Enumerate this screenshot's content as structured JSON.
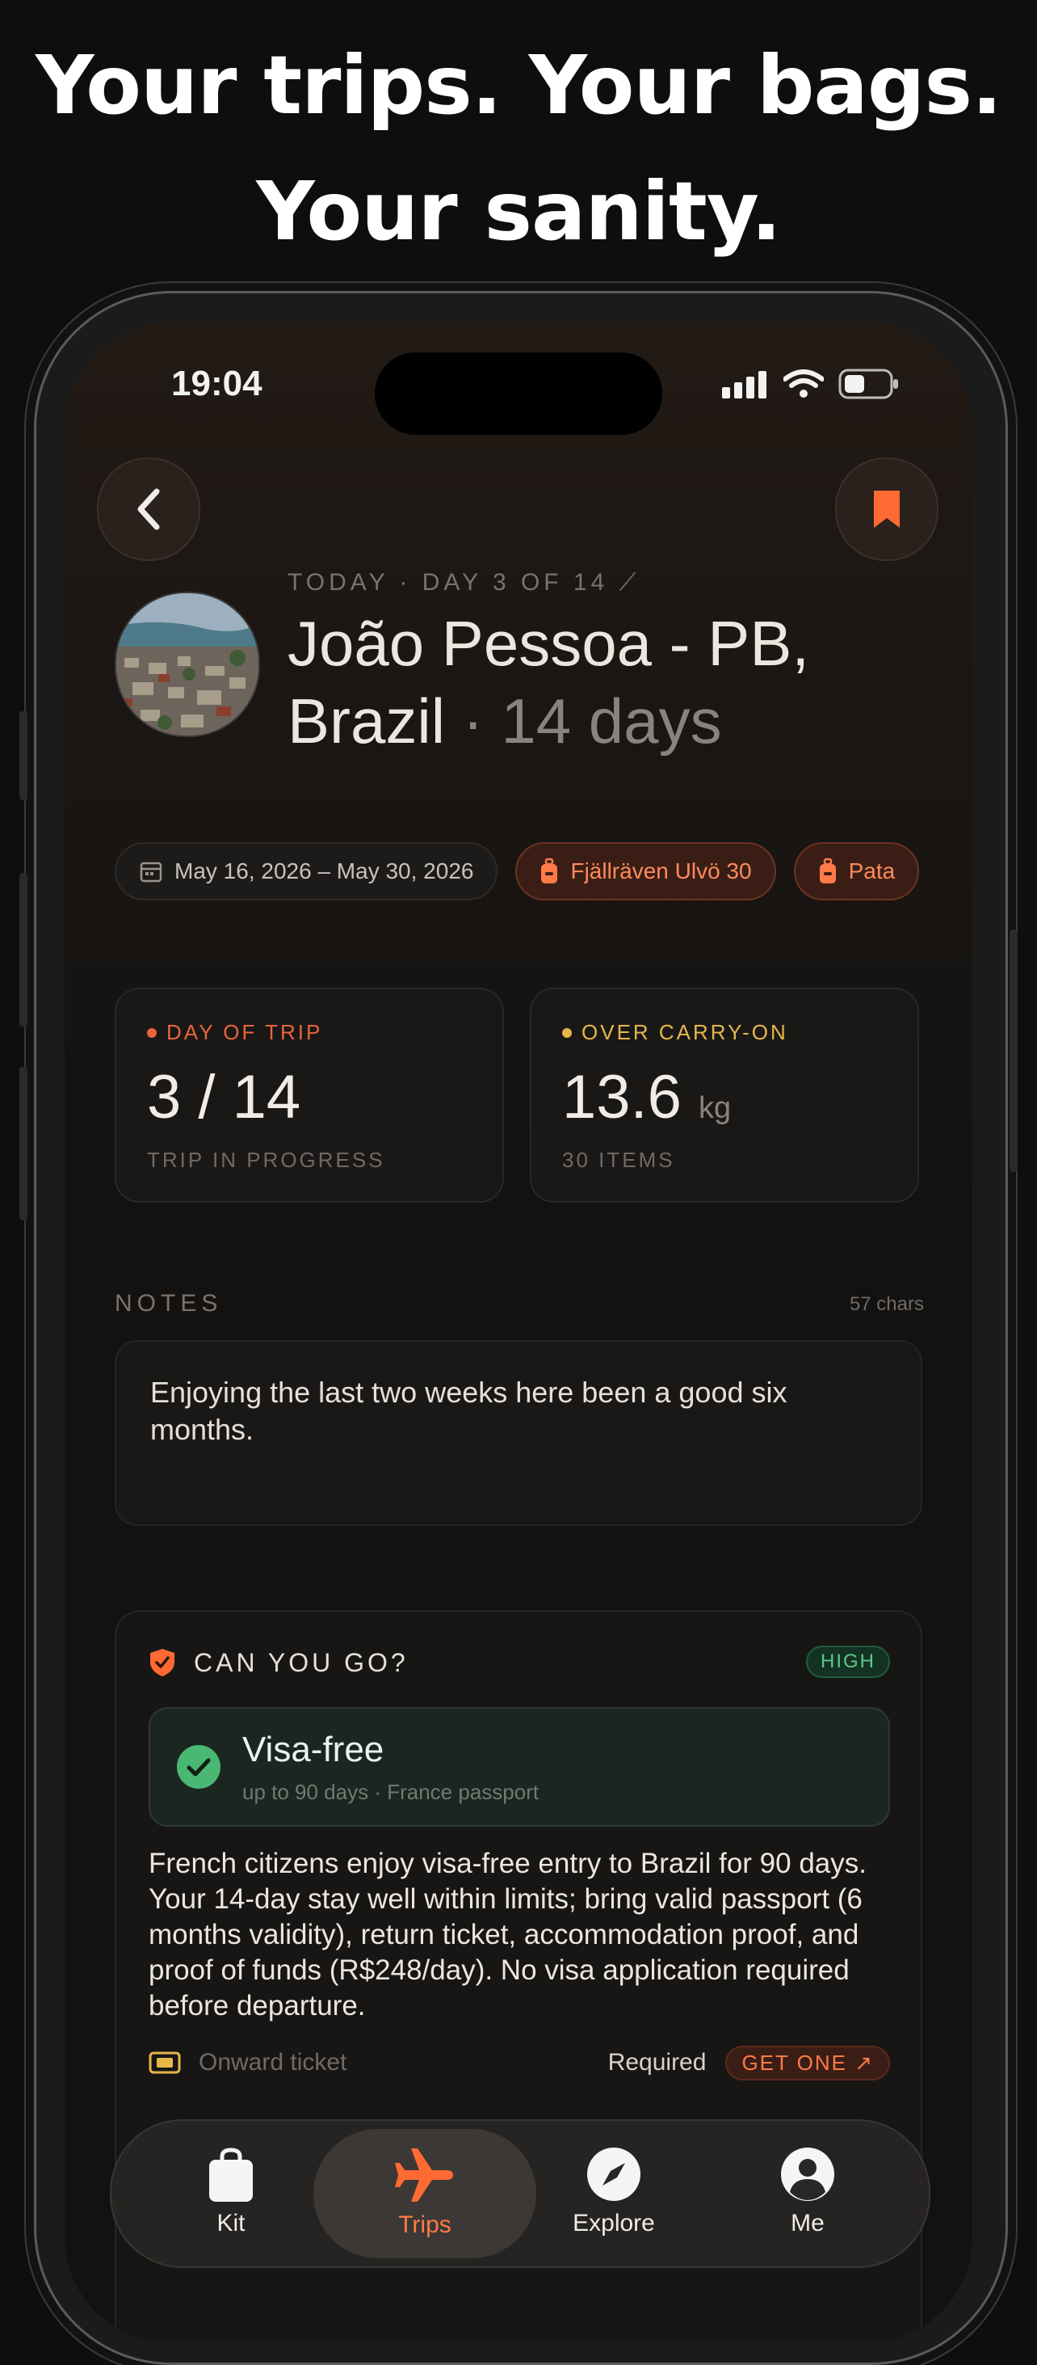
{
  "headline": "Your trips. Your bags. Your sanity.",
  "status": {
    "time": "19:04"
  },
  "trip": {
    "eyebrow": "TODAY · DAY 3 OF 14 ⟋",
    "place": "João Pessoa - PB, Brazil",
    "sep": " · ",
    "duration": "14 days"
  },
  "chips": {
    "dates": "May 16, 2026 – May 30, 2026",
    "bag1": "Fjällräven Ulvö 30",
    "bag2": "Pata"
  },
  "stats": [
    {
      "label": "DAY OF TRIP",
      "value": "3 / 14",
      "unit": "",
      "sub": "TRIP IN PROGRESS",
      "color": "#e8653a"
    },
    {
      "label": "OVER CARRY-ON",
      "value": "13.6",
      "unit": "kg",
      "sub": "30 ITEMS",
      "color": "#e6b84a"
    }
  ],
  "notes": {
    "heading": "NOTES",
    "count": "57 chars",
    "text": "Enjoying the last two weeks here been a good six months."
  },
  "can_go": {
    "title": "CAN YOU GO?",
    "confidence": "HIGH",
    "visa_title": "Visa-free",
    "visa_sub": "up to 90 days · France passport",
    "description": "French citizens enjoy visa-free entry to Brazil for 90 days. Your 14-day stay well within limits; bring valid passport (6 months validity), return ticket, accommodation proof, and proof of funds (R$248/day). No visa application required before departure.",
    "requirement": {
      "label": "Onward ticket",
      "status": "Required",
      "action": "GET ONE ↗"
    }
  },
  "tabs": [
    {
      "label": "Kit",
      "icon": "bag-icon"
    },
    {
      "label": "Trips",
      "icon": "plane-icon"
    },
    {
      "label": "Explore",
      "icon": "compass-icon"
    },
    {
      "label": "Me",
      "icon": "person-icon"
    }
  ],
  "colors": {
    "accent": "#ff7a47",
    "success": "#5cc98a",
    "warning": "#e6b84a"
  }
}
